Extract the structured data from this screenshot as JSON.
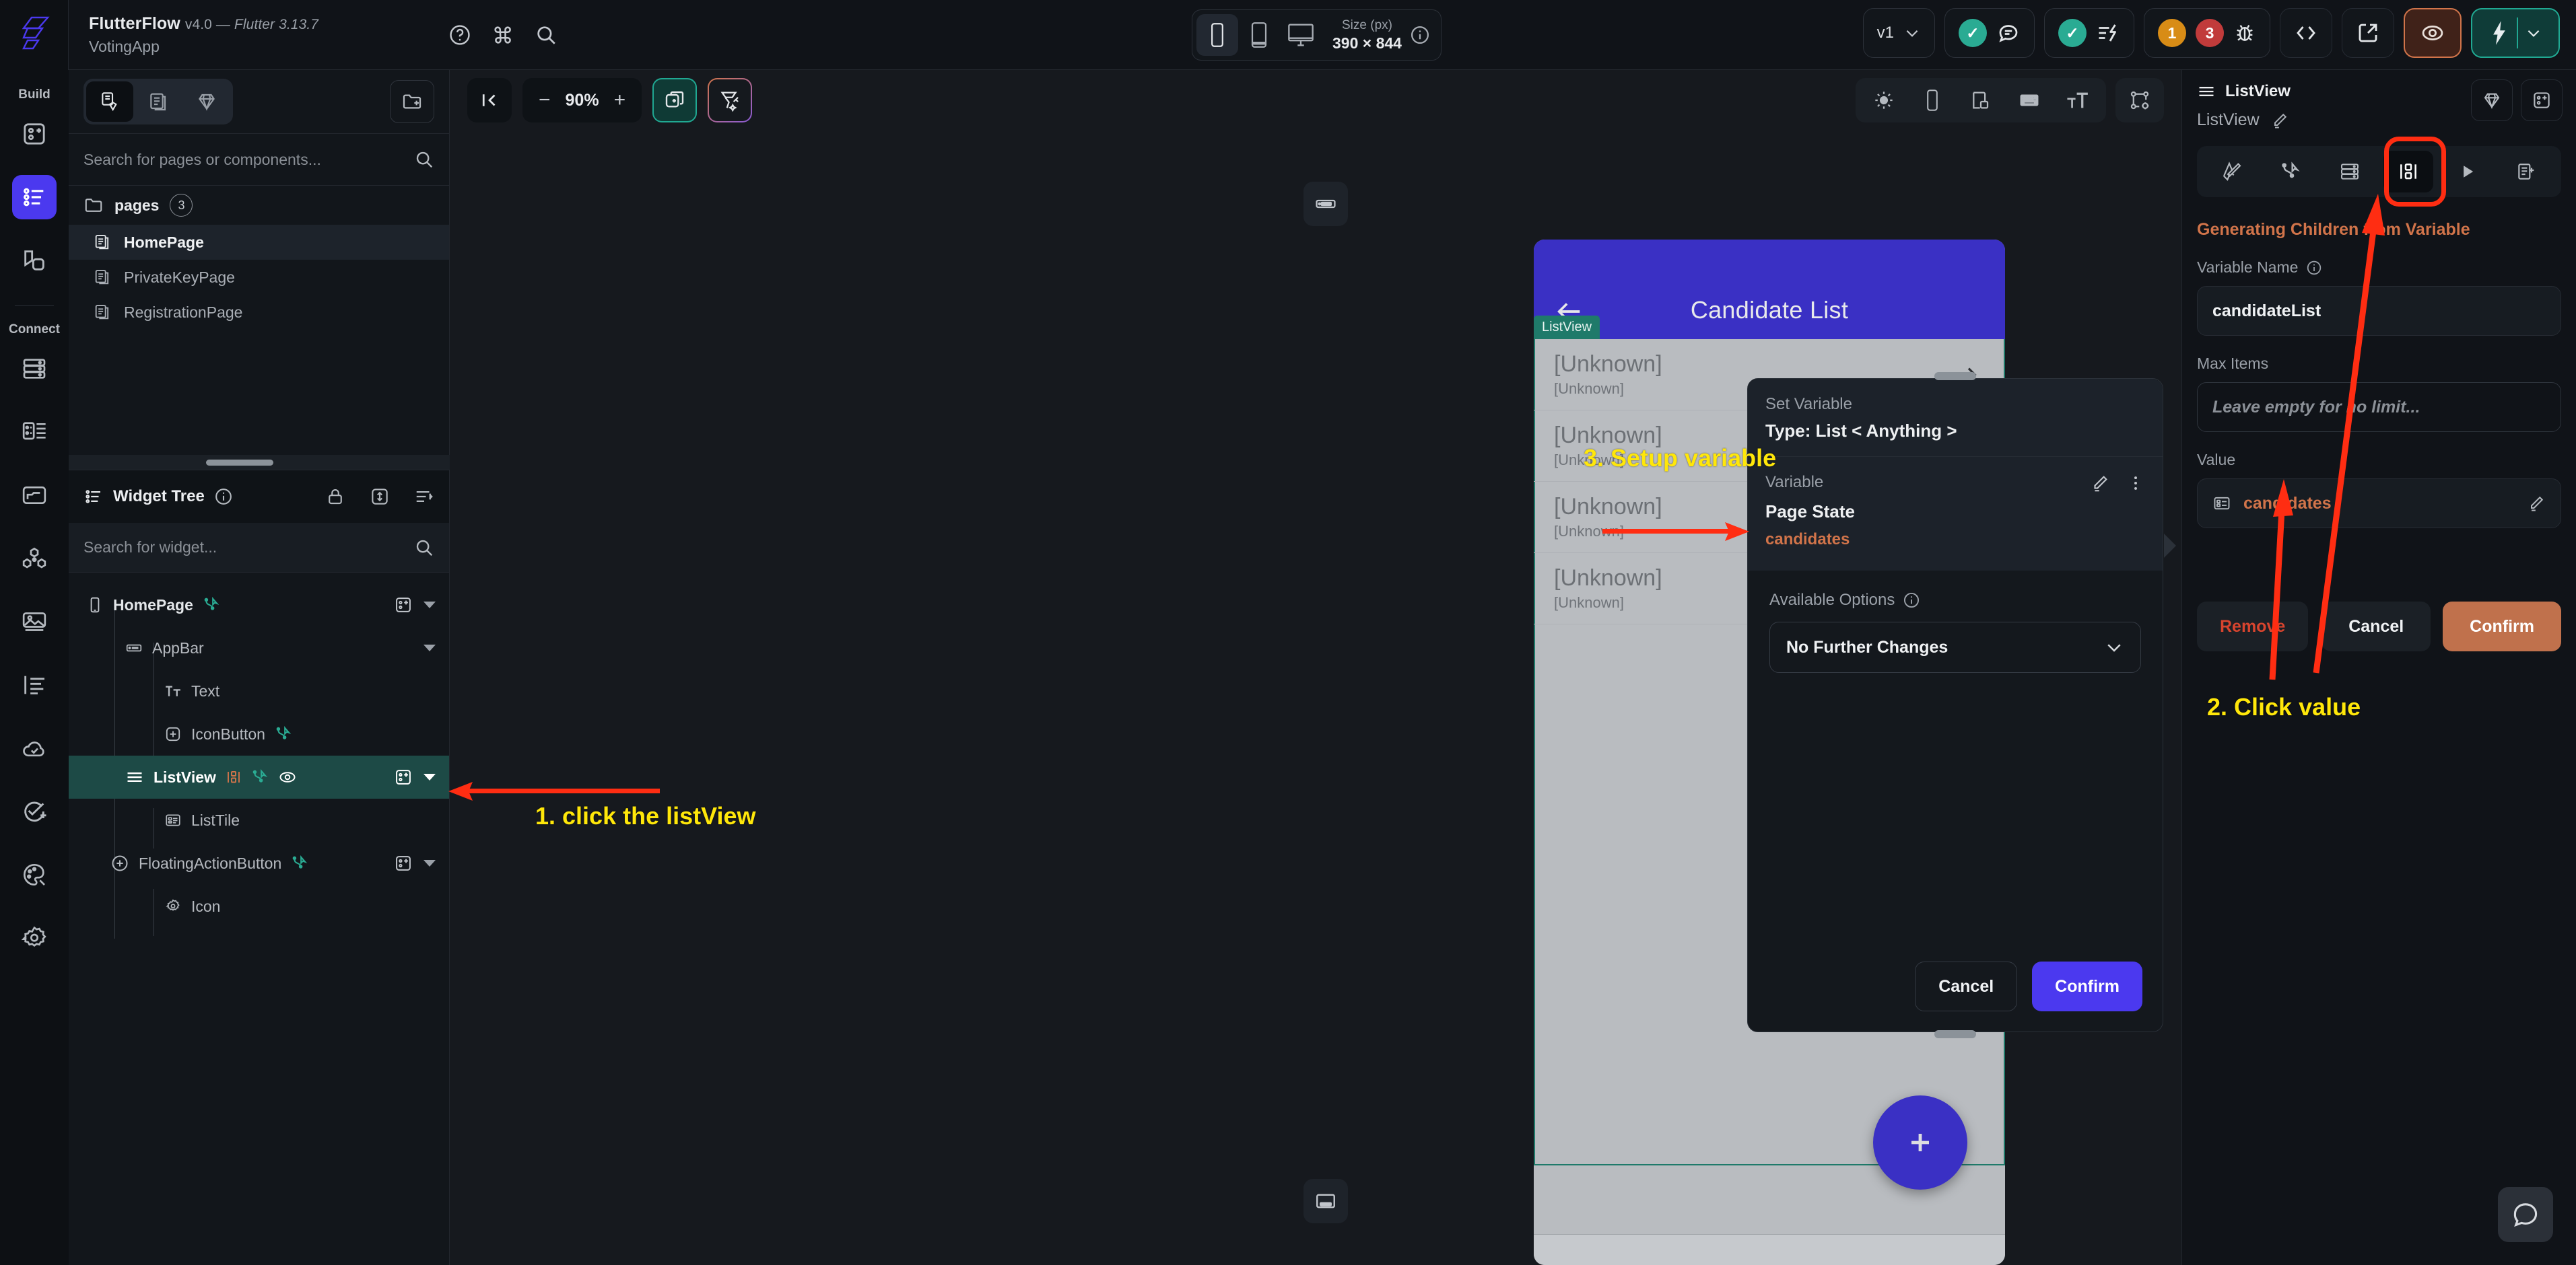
{
  "topbar": {
    "product_name": "FlutterFlow",
    "version": "v4.0 — ",
    "flutter_version": "Flutter 3.13.7",
    "project_name": "VotingApp",
    "size_label": "Size (px)",
    "size_value": "390 × 844",
    "version_pill": "v1",
    "warn_count": "1",
    "error_count": "3",
    "icons": {
      "help": "help-circle-icon",
      "command": "command-icon",
      "search": "search-icon",
      "phone": "phone-icon",
      "tablet": "tablet-icon",
      "desktop": "desktop-icon",
      "info": "info-icon",
      "chevron": "chevron-down-icon",
      "check": "check-icon",
      "comment": "comment-icon",
      "bolt": "bolt-icon",
      "bug": "bug-icon",
      "code": "code-icon",
      "launch": "launch-icon",
      "eye": "eye-icon"
    }
  },
  "rail": {
    "build_label": "Build",
    "connect_label": "Connect",
    "items": [
      "add-widget-icon",
      "page-selector-icon",
      "components-icon",
      "database-icon",
      "app-state-icon",
      "storage-icon",
      "integrations-icon",
      "media-icon",
      "localization-icon",
      "deploy-icon",
      "tests-icon",
      "theme-icon",
      "settings-icon"
    ]
  },
  "pages_panel": {
    "segments": [
      "pages-and-components-icon",
      "pages-icon",
      "components-icon"
    ],
    "new_folder_icon": "new-folder-icon",
    "search_placeholder": "Search for pages or components...",
    "folder_name": "pages",
    "folder_count": "3",
    "items": [
      {
        "label": "HomePage",
        "selected": true
      },
      {
        "label": "PrivateKeyPage",
        "selected": false
      },
      {
        "label": "RegistrationPage",
        "selected": false
      }
    ]
  },
  "widget_tree": {
    "title": "Widget Tree",
    "search_placeholder": "Search for widget...",
    "header_icons": [
      "info-icon",
      "lock-icon",
      "expand-collapse-icon",
      "sort-icon"
    ],
    "nodes": [
      {
        "label": "HomePage",
        "indent": 0,
        "icon": "phone-icon",
        "bold": true,
        "selected": false,
        "has_action": true,
        "has_add": true,
        "has_caret": true,
        "has_eye": false,
        "has_list_badge": false
      },
      {
        "label": "AppBar",
        "indent": 1,
        "icon": "appbar-icon",
        "bold": false,
        "selected": false,
        "has_action": false,
        "has_add": false,
        "has_caret": true,
        "has_eye": false,
        "has_list_badge": false
      },
      {
        "label": "Text",
        "indent": 2,
        "icon": "text-icon",
        "bold": false,
        "selected": false,
        "has_action": false,
        "has_add": false,
        "has_caret": false,
        "has_eye": false,
        "has_list_badge": false
      },
      {
        "label": "IconButton",
        "indent": 2,
        "icon": "plus-box-icon",
        "bold": false,
        "selected": false,
        "has_action": true,
        "has_add": false,
        "has_caret": false,
        "has_eye": false,
        "has_list_badge": false
      },
      {
        "label": "ListView",
        "indent": 1,
        "icon": "listview-icon",
        "bold": true,
        "selected": true,
        "has_action": true,
        "has_add": true,
        "has_caret": true,
        "has_eye": true,
        "has_list_badge": true
      },
      {
        "label": "ListTile",
        "indent": 2,
        "icon": "listtile-icon",
        "bold": false,
        "selected": false,
        "has_action": false,
        "has_add": false,
        "has_caret": false,
        "has_eye": false,
        "has_list_badge": false
      },
      {
        "label": "FloatingActionButton",
        "indent": 1,
        "icon": "fab-icon",
        "bold": false,
        "selected": false,
        "has_action": true,
        "has_add": true,
        "has_caret": true,
        "has_eye": false,
        "has_list_badge": false
      },
      {
        "label": "Icon",
        "indent": 2,
        "icon": "gear-icon",
        "bold": false,
        "selected": false,
        "has_action": false,
        "has_add": false,
        "has_caret": false,
        "has_eye": false,
        "has_list_badge": false
      }
    ]
  },
  "canvas_toolbar": {
    "collapse_icon": "collapse-left-icon",
    "zoom_minus": "−",
    "zoom_value": "90%",
    "zoom_plus": "+",
    "duplicate_icon": "add-frame-icon",
    "magic_icon": "ai-generate-icon",
    "right_icons": [
      "brightness-icon",
      "device-frame-icon",
      "split-view-icon",
      "keyboard-icon",
      "text-size-icon",
      "layout-settings-icon"
    ]
  },
  "phone_preview": {
    "appbar_title": "Candidate List",
    "back_icon": "arrow-back-icon",
    "listview_tag": "ListView",
    "appbar_marker_icon": "appbar-icon",
    "bottom_marker_icon": "bottom-bar-icon",
    "fab_icon": "plus-icon",
    "tiles": [
      {
        "title": "[Unknown]",
        "subtitle": "[Unknown]"
      },
      {
        "title": "[Unknown]",
        "subtitle": "[Unknown]"
      },
      {
        "title": "[Unknown]",
        "subtitle": "[Unknown]"
      },
      {
        "title": "[Unknown]",
        "subtitle": "[Unknown]"
      }
    ]
  },
  "set_variable_dialog": {
    "header_label": "Set Variable",
    "type_label": "Type: List < Anything >",
    "variable_label": "Variable",
    "variable_source": "Page State",
    "variable_value": "candidates",
    "edit_icon": "pencil-icon",
    "more_icon": "more-vertical-icon",
    "options_label": "Available Options",
    "options_info_icon": "info-icon",
    "options_value": "No Further Changes",
    "options_chevron": "chevron-down-icon",
    "cancel_label": "Cancel",
    "confirm_label": "Confirm"
  },
  "right_panel": {
    "widget_name": "ListView",
    "widget_subname": "ListView",
    "rename_icon": "pencil-icon",
    "theme_icon": "diamond-icon",
    "add_widget_icon": "add-widget-icon",
    "tabs": [
      {
        "icon": "design-icon",
        "active": false
      },
      {
        "icon": "actions-icon",
        "active": false
      },
      {
        "icon": "backend-icon",
        "active": false
      },
      {
        "icon": "generate-children-icon",
        "active": true
      },
      {
        "icon": "animations-icon",
        "active": false
      },
      {
        "icon": "docs-icon",
        "active": false
      }
    ],
    "section_title": "Generating Children from Variable",
    "variable_name_label": "Variable Name",
    "variable_name_info_icon": "info-icon",
    "variable_name_value": "candidateList",
    "max_items_label": "Max Items",
    "max_items_placeholder": "Leave empty for no limit...",
    "value_label": "Value",
    "value_icon": "page-state-icon",
    "value_text": "candidates",
    "value_edit_icon": "pencil-icon",
    "remove_label": "Remove",
    "cancel_label": "Cancel",
    "confirm_label": "Confirm"
  },
  "annotations": [
    {
      "text": "1. click the listView"
    },
    {
      "text": "2. Click value"
    },
    {
      "text": "3. Setup variable"
    }
  ],
  "chat": {
    "icon": "chat-icon"
  },
  "colors": {
    "accent_purple": "#4b39ef",
    "accent_teal": "#20a892",
    "accent_orange": "#d1744a",
    "annotation_yellow": "#ffe70a",
    "arrow_red": "#ff2d12",
    "appbar_blue": "#3a30c4"
  }
}
